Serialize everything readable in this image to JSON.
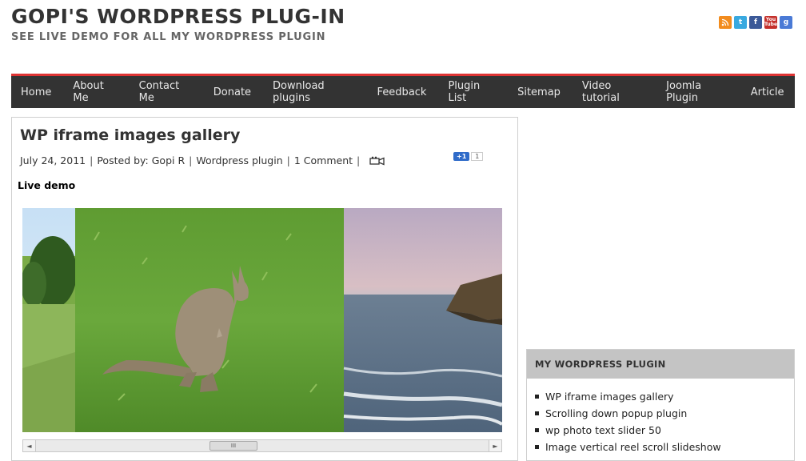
{
  "site": {
    "title": "GOPI'S WORDPRESS PLUG-IN",
    "subtitle": "SEE LIVE DEMO FOR ALL MY WORDPRESS PLUGIN"
  },
  "social": {
    "rss_icon": "rss-icon",
    "twitter_glyph": "t",
    "facebook_glyph": "f",
    "youtube_top": "You",
    "youtube_bottom": "Tube",
    "google_glyph": "g"
  },
  "nav": {
    "items": [
      "Home",
      "About Me",
      "Contact Me",
      "Donate",
      "Download plugins",
      "Feedback",
      "Plugin List",
      "Sitemap",
      "Video tutorial",
      "Joomla Plugin",
      "Article"
    ]
  },
  "post": {
    "title": "WP iframe images gallery",
    "date": "July 24, 2011",
    "posted_by_label": "Posted by:",
    "author": "Gopi R",
    "category": "Wordpress plugin",
    "comments": "1 Comment",
    "plusone_label": "+1",
    "plusone_count": "1",
    "live_demo": "Live demo",
    "scrollbar_left": "◄",
    "scrollbar_right": "►",
    "scrollbar_grip": "III"
  },
  "widget": {
    "title": "MY WORDPRESS PLUGIN",
    "items": [
      "WP iframe images gallery",
      "Scrolling down popup plugin",
      "wp photo text slider 50",
      "Image vertical reel scroll slideshow"
    ]
  },
  "colors": {
    "nav_bg": "#333333",
    "nav_accent": "#dd3333",
    "widget_header": "#c4c4c4"
  }
}
